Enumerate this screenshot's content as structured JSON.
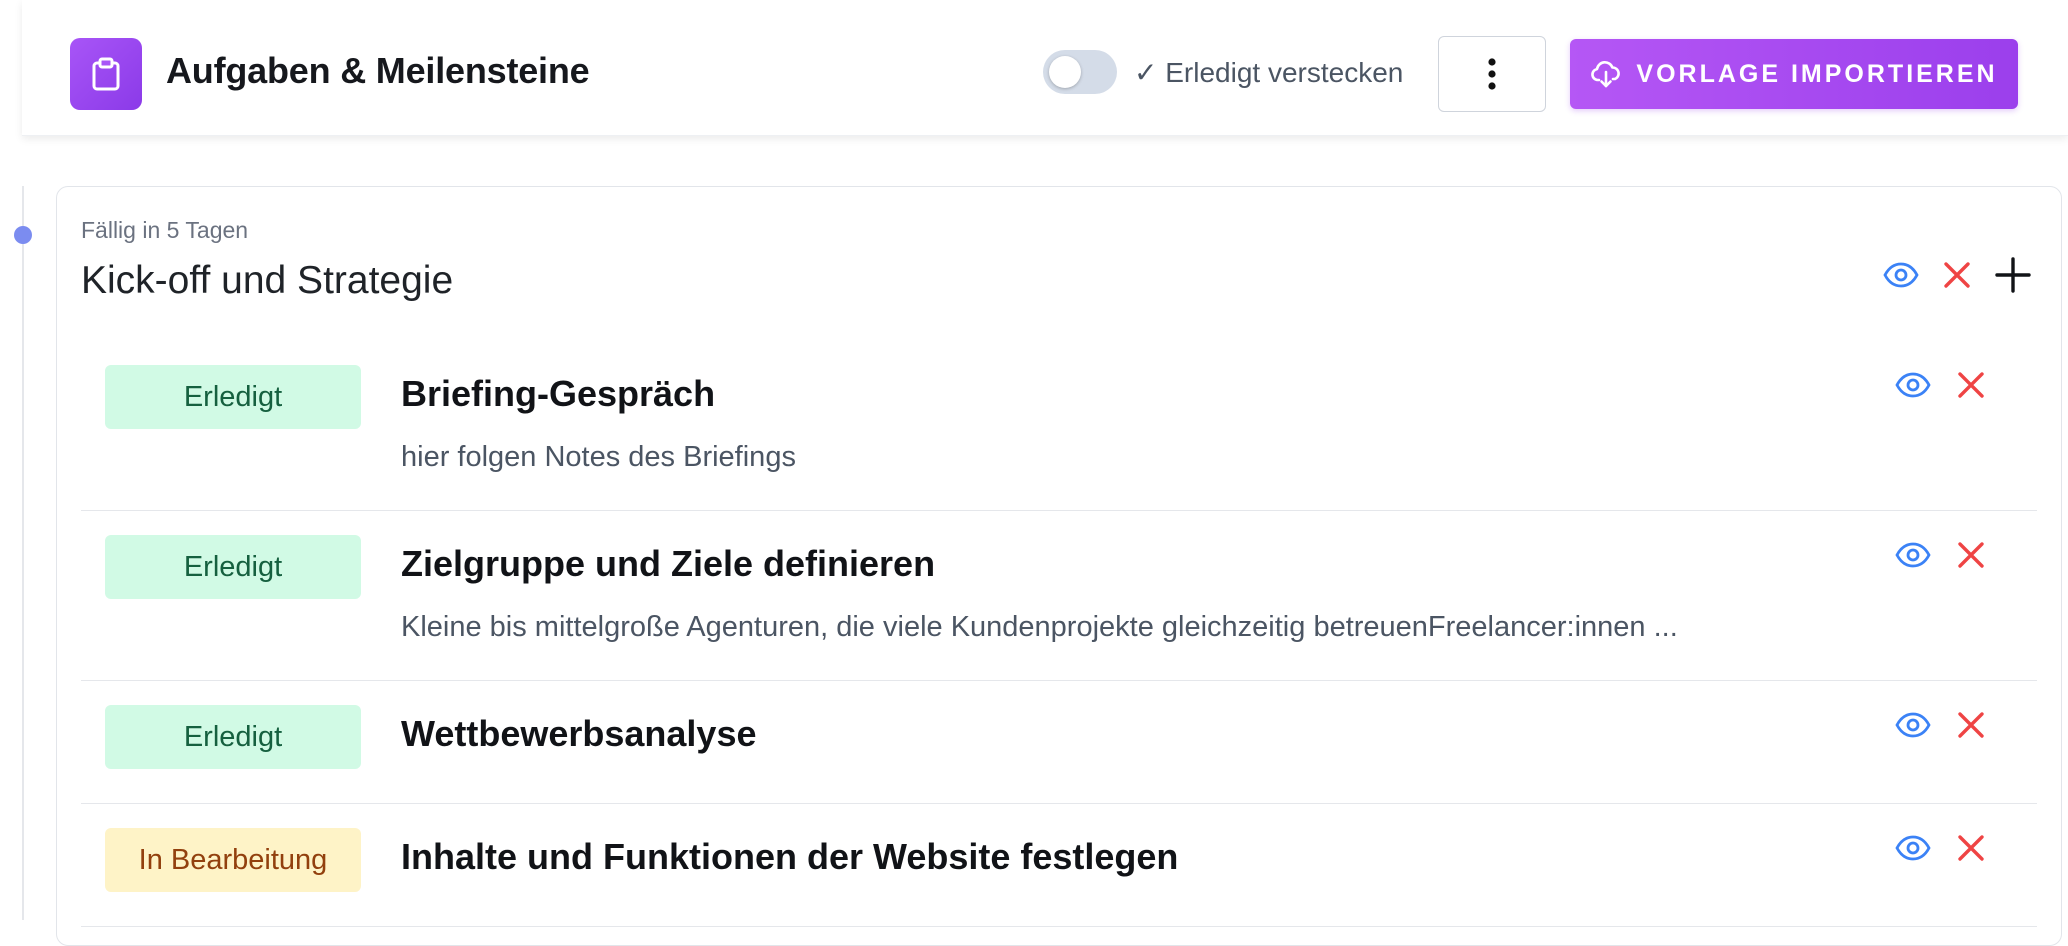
{
  "header": {
    "title": "Aufgaben & Meilensteine",
    "app_icon": "clipboard-icon",
    "toggle_label": "✓ Erledigt verstecken",
    "toggle_on": false,
    "more_icon": "more-vertical-icon",
    "import_button_label": "VORLAGE IMPORTIEREN",
    "import_icon": "cloud-download-icon"
  },
  "colors": {
    "accent": "#a855f7",
    "done_badge_bg": "#d1fae5",
    "done_badge_text": "#15603f",
    "progress_badge_bg": "#fef3c7",
    "progress_badge_text": "#92400e",
    "eye_icon": "#3b82f6",
    "delete_icon": "#ef4444",
    "timeline_dot": "#7b8cf0"
  },
  "milestone": {
    "due": "Fällig in 5 Tagen",
    "title": "Kick-off und Strategie",
    "actions": [
      "eye-icon",
      "close-icon",
      "plus-icon"
    ],
    "tasks": [
      {
        "status": "Erledigt",
        "title": "Briefing-Gespräch",
        "description": "hier folgen Notes des Briefings"
      },
      {
        "status": "Erledigt",
        "title": "Zielgruppe und Ziele definieren",
        "description": "Kleine bis mittelgroße Agenturen, die viele Kundenprojekte gleichzeitig betreuenFreelancer:innen ..."
      },
      {
        "status": "Erledigt",
        "title": "Wettbewerbsanalyse",
        "description": ""
      },
      {
        "status": "In Bearbeitung",
        "title": "Inhalte und Funktionen der Website festlegen",
        "description": ""
      }
    ]
  }
}
